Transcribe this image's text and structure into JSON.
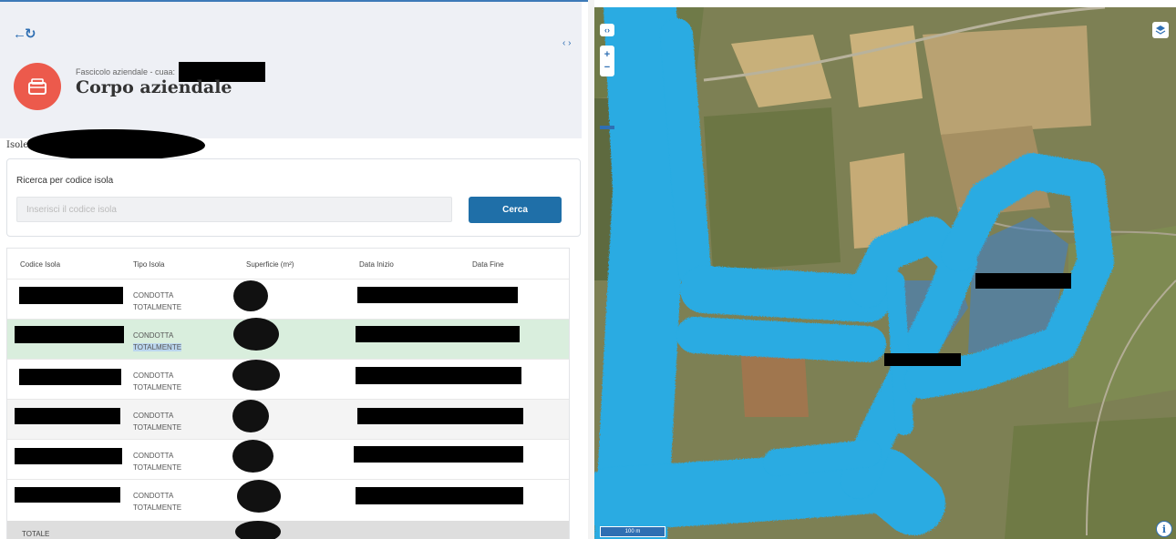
{
  "header": {
    "subtitle": "Fascicolo aziendale - cuaa:",
    "title": "Corpo aziendale"
  },
  "isole_label": "Isole",
  "search": {
    "label": "Ricerca per codice isola",
    "placeholder": "Inserisci il codice isola",
    "button_label": "Cerca"
  },
  "table": {
    "headers": [
      "Codice Isola",
      "Tipo Isola",
      "Superficie (m²)",
      "Data Inizio",
      "Data Fine"
    ],
    "rows": [
      {
        "tipo_line1": "CONDOTTA",
        "tipo_line2": "TOTALMENTE"
      },
      {
        "tipo_line1": "CONDOTTA",
        "tipo_line2": "TOTALMENTE"
      },
      {
        "tipo_line1": "CONDOTTA",
        "tipo_line2": "TOTALMENTE"
      },
      {
        "tipo_line1": "CONDOTTA",
        "tipo_line2": "TOTALMENTE"
      },
      {
        "tipo_line1": "CONDOTTA",
        "tipo_line2": "TOTALMENTE"
      },
      {
        "tipo_line1": "CONDOTTA",
        "tipo_line2": "TOTALMENTE"
      }
    ],
    "total_label": "TOTALE"
  },
  "map": {
    "scale_label": "100 m"
  },
  "colors": {
    "accent": "#1f6fa8",
    "logo": "#ec5a4c",
    "selected_row": "#d9eedd",
    "parcel_outline": "#29abe2"
  },
  "icons": [
    "back-arrow-icon",
    "refresh-icon",
    "collapse-icon",
    "folder-icon",
    "layers-icon",
    "info-icon",
    "zoom-in-icon",
    "zoom-out-icon",
    "expand-icon"
  ]
}
